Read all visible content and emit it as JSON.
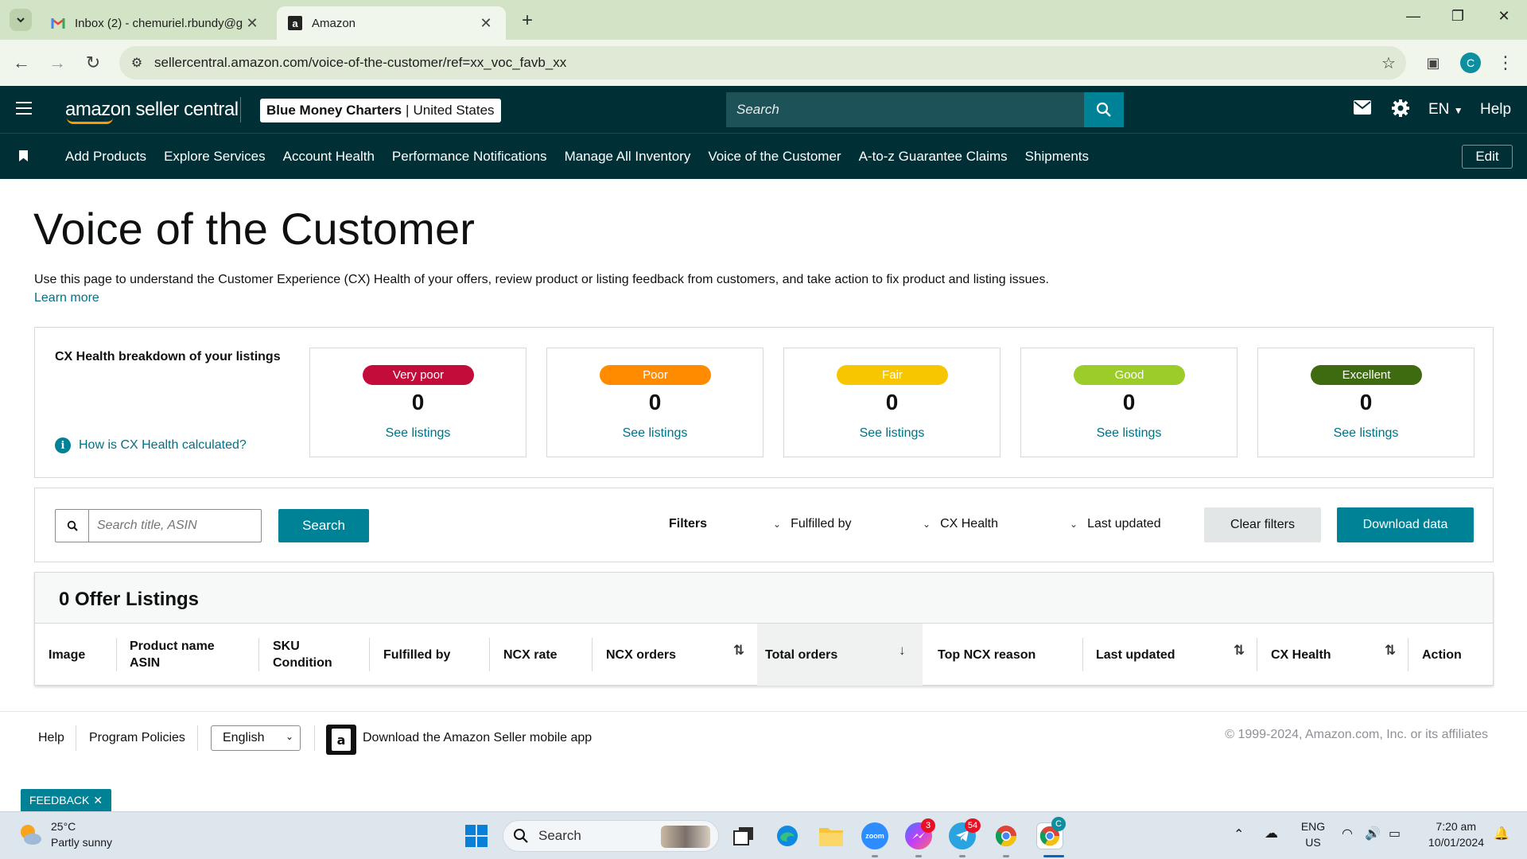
{
  "browser": {
    "tabs": [
      {
        "title": "Inbox (2) - chemuriel.rbundy@g",
        "active": false,
        "icon": "gmail-icon"
      },
      {
        "title": "Amazon",
        "active": true,
        "icon": "amazon-icon"
      }
    ],
    "url": "sellercentral.amazon.com/voice-of-the-customer/ref=xx_voc_favb_xx",
    "profile_initial": "C"
  },
  "header": {
    "logo": "amazon seller central",
    "account_name": "Blue Money Charters",
    "account_region": "United States",
    "search_placeholder": "Search",
    "language": "EN",
    "help": "Help"
  },
  "nav": {
    "items": [
      "Add Products",
      "Explore Services",
      "Account Health",
      "Performance Notifications",
      "Manage All Inventory",
      "Voice of the Customer",
      "A-to-z Guarantee Claims",
      "Shipments"
    ],
    "edit": "Edit"
  },
  "page": {
    "title": "Voice of the Customer",
    "intro": "Use this page to understand the Customer Experience (CX) Health of your offers, review product or listing feedback from customers, and take action to fix product and listing issues.",
    "learn_more": "Learn more"
  },
  "cx_health": {
    "title": "CX Health breakdown of your listings",
    "how_link": "How is CX Health calculated?",
    "cards": [
      {
        "label": "Very poor",
        "count": "0",
        "link": "See listings",
        "color": "#c40c3b"
      },
      {
        "label": "Poor",
        "count": "0",
        "link": "See listings",
        "color": "#ff8c00"
      },
      {
        "label": "Fair",
        "count": "0",
        "link": "See listings",
        "color": "#f7c600"
      },
      {
        "label": "Good",
        "count": "0",
        "link": "See listings",
        "color": "#9ccc2a"
      },
      {
        "label": "Excellent",
        "count": "0",
        "link": "See listings",
        "color": "#3e6b10"
      }
    ]
  },
  "filters": {
    "search_placeholder": "Search title, ASIN",
    "search_button": "Search",
    "label": "Filters",
    "dropdowns": [
      "Fulfilled by",
      "CX Health",
      "Last updated"
    ],
    "clear": "Clear filters",
    "download": "Download data"
  },
  "table": {
    "title": "0 Offer Listings",
    "columns": [
      {
        "line1": "Image",
        "line2": ""
      },
      {
        "line1": "Product name",
        "line2": "ASIN"
      },
      {
        "line1": "SKU",
        "line2": "Condition"
      },
      {
        "line1": "Fulfilled by",
        "line2": ""
      },
      {
        "line1": "NCX rate",
        "line2": ""
      },
      {
        "line1": "NCX orders",
        "line2": ""
      },
      {
        "line1": "Total orders",
        "line2": ""
      },
      {
        "line1": "Top NCX reason",
        "line2": ""
      },
      {
        "line1": "Last updated",
        "line2": ""
      },
      {
        "line1": "CX Health",
        "line2": ""
      },
      {
        "line1": "Action",
        "line2": ""
      }
    ],
    "sorted_column": "Total orders"
  },
  "footer": {
    "help": "Help",
    "policies": "Program Policies",
    "language": "English",
    "app": "Download the Amazon Seller mobile app",
    "copyright": "© 1999-2024, Amazon.com, Inc. or its affiliates",
    "feedback": "FEEDBACK"
  },
  "taskbar": {
    "weather_temp": "25°C",
    "weather_desc": "Partly sunny",
    "search": "Search",
    "messenger_badge": "3",
    "telegram_badge": "54",
    "chrome_badge": "C",
    "lang_top": "ENG",
    "lang_bottom": "US",
    "time": "7:20 am",
    "date": "10/01/2024",
    "zoom_label": "zoom"
  }
}
